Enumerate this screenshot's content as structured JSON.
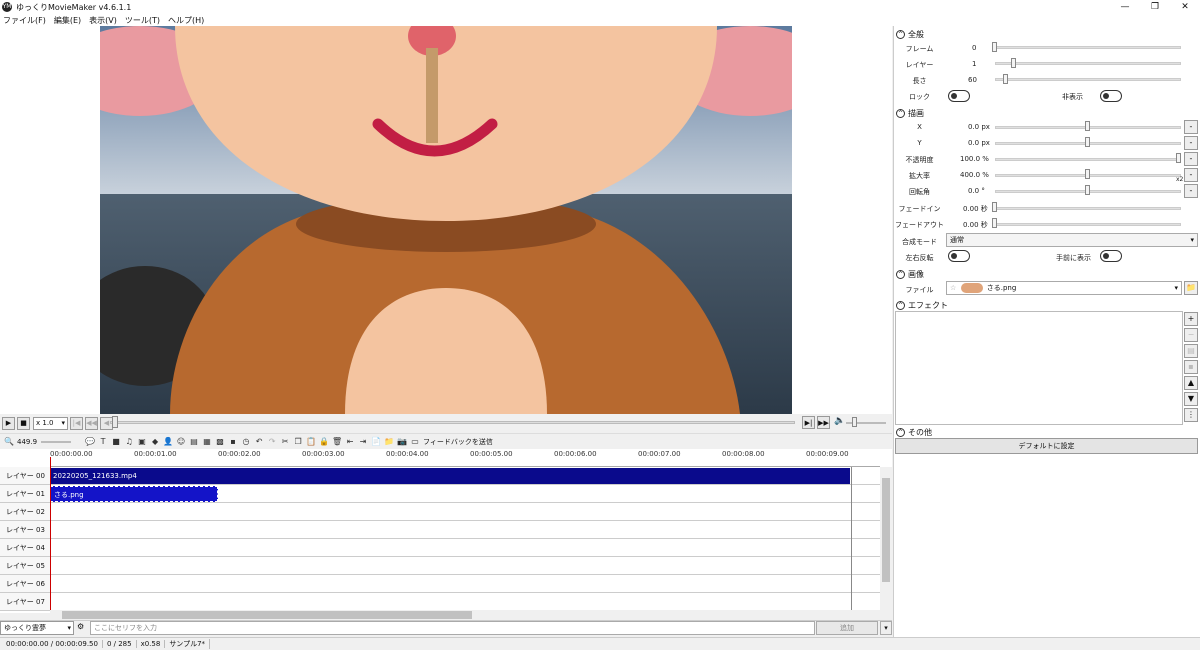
{
  "window": {
    "title": "ゆっくりMovieMaker v4.6.1.1",
    "app_icon_glyph": "YM",
    "minimize": "—",
    "maximize": "❐",
    "close": "✕"
  },
  "menu": [
    "ファイル(F)",
    "編集(E)",
    "表示(V)",
    "ツール(T)",
    "ヘルプ(H)"
  ],
  "transport": {
    "speed": "x 1.0"
  },
  "toolbar": {
    "zoom_value": "449.9",
    "feedback_label": "フィードバックを送信"
  },
  "timeline": {
    "ticks": [
      "00:00:00.00",
      "00:00:01.00",
      "00:00:02.00",
      "00:00:03.00",
      "00:00:04.00",
      "00:00:05.00",
      "00:00:06.00",
      "00:00:07.00",
      "00:00:08.00",
      "00:00:09.00"
    ],
    "layers": [
      "レイヤー 00",
      "レイヤー 01",
      "レイヤー 02",
      "レイヤー 03",
      "レイヤー 04",
      "レイヤー 05",
      "レイヤー 06",
      "レイヤー 07"
    ],
    "clips": [
      {
        "layer": 0,
        "label": "20220205_121633.mp4",
        "color": "#0a0a8c"
      },
      {
        "layer": 1,
        "label": "さる.png",
        "color": "#1414c8"
      }
    ]
  },
  "input_bar": {
    "character": "ゆっくり霊夢",
    "placeholder": "ここにセリフを入力",
    "add_label": "追加"
  },
  "status": [
    "00:00:00.00 / 00:00:09.50",
    "0 / 285",
    "x0.58",
    "サンプル7*"
  ],
  "panel": {
    "general": {
      "title": "全般",
      "frame_label": "フレーム",
      "frame_value": "0",
      "layer_label": "レイヤー",
      "layer_value": "1",
      "length_label": "長さ",
      "length_value": "60",
      "lock_label": "ロック",
      "hide_label": "非表示"
    },
    "drawing": {
      "title": "描画",
      "x_label": "X",
      "x_value": "0.0 px",
      "y_label": "Y",
      "y_value": "0.0 px",
      "opacity_label": "不透明度",
      "opacity_value": "100.0 %",
      "scale_label": "拡大率",
      "scale_value": "400.0 %",
      "scale_suffix": "x2",
      "rotation_label": "回転角",
      "rotation_value": "0.0 °",
      "fadein_label": "フェードイン",
      "fadein_value": "0.00 秒",
      "fadeout_label": "フェードアウト",
      "fadeout_value": "0.00 秒",
      "blend_label": "合成モード",
      "blend_value": "通常",
      "flip_label": "左右反転",
      "front_label": "手前に表示"
    },
    "image": {
      "title": "画像",
      "file_label": "ファイル",
      "file_value": "さる.png"
    },
    "effect": {
      "title": "エフェクト"
    },
    "other": {
      "title": "その他",
      "default_button": "デフォルトに設定"
    }
  },
  "colors": {
    "accent": "#0a0a8c",
    "playhead": "#cc0000"
  }
}
